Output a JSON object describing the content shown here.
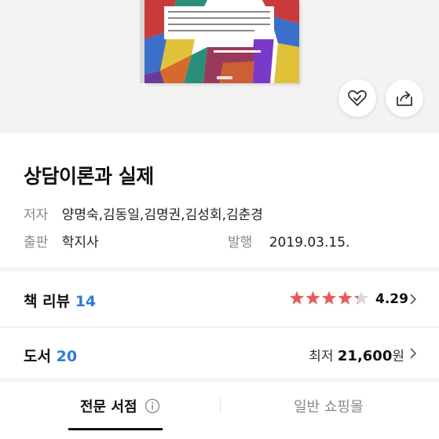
{
  "book": {
    "title": "상담이론과 실제",
    "author_label": "저자",
    "authors": "양명숙,김동일,김명권,김성회,김춘경",
    "publisher_label": "출판",
    "publisher": "학지사",
    "published_label": "발행",
    "published_date": "2019.03.15."
  },
  "review": {
    "label": "책 리뷰",
    "count": "14",
    "rating": "4.29",
    "rating_value": 4.29,
    "star_color": "#e85a5a"
  },
  "books": {
    "label": "도서",
    "count": "20",
    "price_prefix": "최저",
    "price": "21,600",
    "price_unit": "원"
  },
  "tabs": {
    "active": "전문 서점",
    "inactive": "일반 쇼핑몰"
  },
  "colors": {
    "accent": "#2f7bd4"
  },
  "icons": {
    "wishlist": "heart-check-icon",
    "share": "share-icon",
    "info": "info-icon",
    "chevron": "chevron-right-icon"
  }
}
